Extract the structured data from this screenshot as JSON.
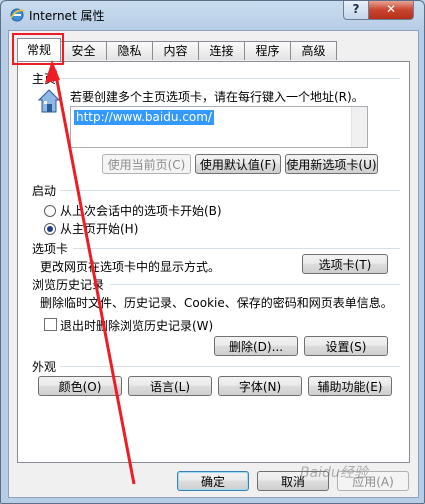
{
  "window": {
    "title": "Internet 属性",
    "help": "?",
    "close": "✕"
  },
  "tabs": [
    {
      "label": "常规",
      "active": true
    },
    {
      "label": "安全"
    },
    {
      "label": "隐私"
    },
    {
      "label": "内容"
    },
    {
      "label": "连接"
    },
    {
      "label": "程序"
    },
    {
      "label": "高级"
    }
  ],
  "homepage": {
    "section": "主页",
    "description": "若要创建多个主页选项卡，请在每行键入一个地址(R)。",
    "url": "http://www.baidu.com/",
    "use_current": "使用当前页(C)",
    "use_default": "使用默认值(F)",
    "use_new_tab": "使用新选项卡(U)"
  },
  "startup": {
    "section": "启动",
    "option_last": "从上次会话中的选项卡开始(B)",
    "option_home": "从主页开始(H)",
    "selected": "option_home"
  },
  "tabs_section": {
    "section": "选项卡",
    "description": "更改网页在选项卡中的显示方式。",
    "button": "选项卡(T)"
  },
  "history": {
    "section": "浏览历史记录",
    "description": "删除临时文件、历史记录、Cookie、保存的密码和网页表单信息。",
    "checkbox": "退出时删除浏览历史记录(W)",
    "checked": false,
    "delete_button": "删除(D)...",
    "settings_button": "设置(S)"
  },
  "appearance": {
    "section": "外观",
    "colors": "颜色(O)",
    "languages": "语言(L)",
    "fonts": "字体(N)",
    "accessibility": "辅助功能(E)"
  },
  "footer": {
    "ok": "确定",
    "cancel": "取消",
    "apply": "应用(A)"
  },
  "watermark": "Baidu经验",
  "colors": {
    "annotation": "#ee1c25",
    "selection": "#3399ff"
  }
}
